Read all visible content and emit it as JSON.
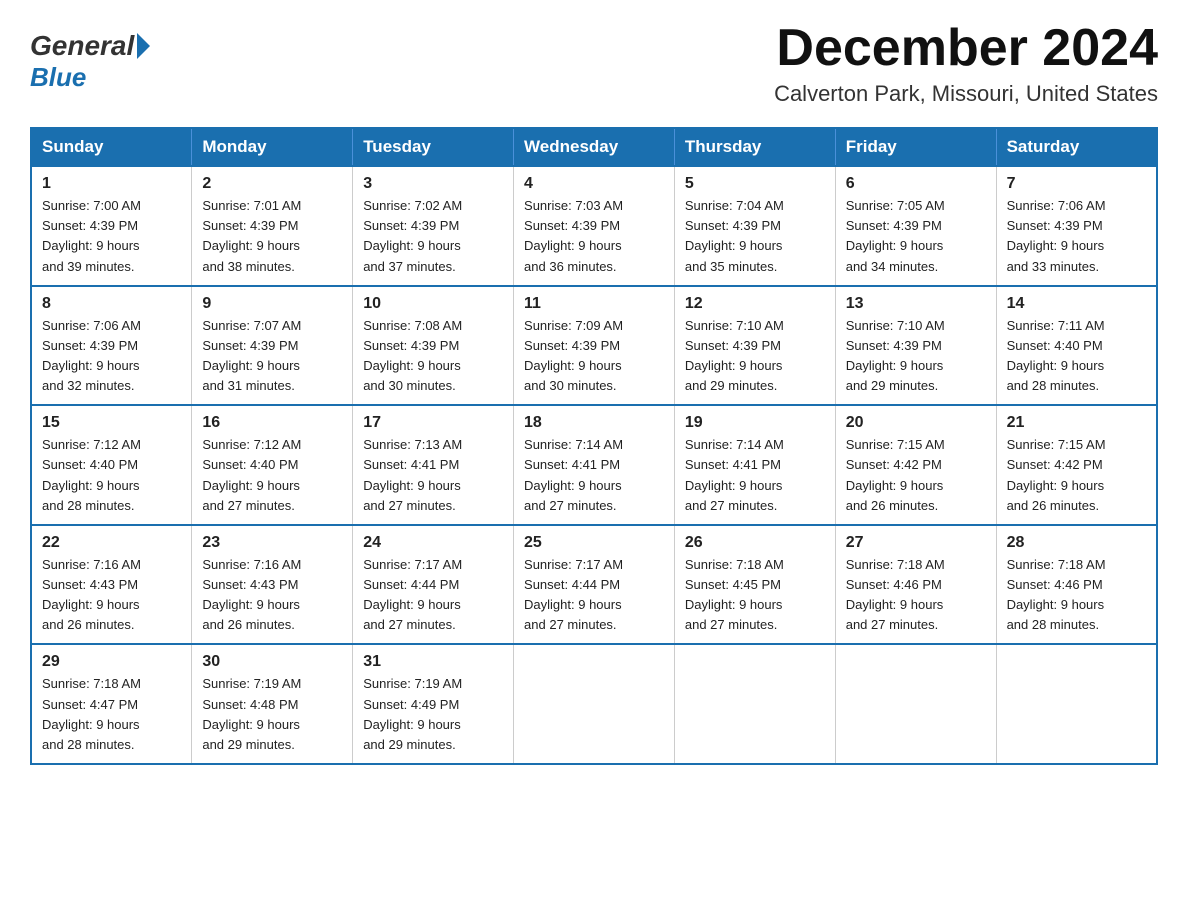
{
  "logo": {
    "general": "General",
    "blue": "Blue"
  },
  "header": {
    "month": "December 2024",
    "location": "Calverton Park, Missouri, United States"
  },
  "days_of_week": [
    "Sunday",
    "Monday",
    "Tuesday",
    "Wednesday",
    "Thursday",
    "Friday",
    "Saturday"
  ],
  "weeks": [
    [
      {
        "day": "1",
        "sunrise": "7:00 AM",
        "sunset": "4:39 PM",
        "daylight": "9 hours and 39 minutes."
      },
      {
        "day": "2",
        "sunrise": "7:01 AM",
        "sunset": "4:39 PM",
        "daylight": "9 hours and 38 minutes."
      },
      {
        "day": "3",
        "sunrise": "7:02 AM",
        "sunset": "4:39 PM",
        "daylight": "9 hours and 37 minutes."
      },
      {
        "day": "4",
        "sunrise": "7:03 AM",
        "sunset": "4:39 PM",
        "daylight": "9 hours and 36 minutes."
      },
      {
        "day": "5",
        "sunrise": "7:04 AM",
        "sunset": "4:39 PM",
        "daylight": "9 hours and 35 minutes."
      },
      {
        "day": "6",
        "sunrise": "7:05 AM",
        "sunset": "4:39 PM",
        "daylight": "9 hours and 34 minutes."
      },
      {
        "day": "7",
        "sunrise": "7:06 AM",
        "sunset": "4:39 PM",
        "daylight": "9 hours and 33 minutes."
      }
    ],
    [
      {
        "day": "8",
        "sunrise": "7:06 AM",
        "sunset": "4:39 PM",
        "daylight": "9 hours and 32 minutes."
      },
      {
        "day": "9",
        "sunrise": "7:07 AM",
        "sunset": "4:39 PM",
        "daylight": "9 hours and 31 minutes."
      },
      {
        "day": "10",
        "sunrise": "7:08 AM",
        "sunset": "4:39 PM",
        "daylight": "9 hours and 30 minutes."
      },
      {
        "day": "11",
        "sunrise": "7:09 AM",
        "sunset": "4:39 PM",
        "daylight": "9 hours and 30 minutes."
      },
      {
        "day": "12",
        "sunrise": "7:10 AM",
        "sunset": "4:39 PM",
        "daylight": "9 hours and 29 minutes."
      },
      {
        "day": "13",
        "sunrise": "7:10 AM",
        "sunset": "4:39 PM",
        "daylight": "9 hours and 29 minutes."
      },
      {
        "day": "14",
        "sunrise": "7:11 AM",
        "sunset": "4:40 PM",
        "daylight": "9 hours and 28 minutes."
      }
    ],
    [
      {
        "day": "15",
        "sunrise": "7:12 AM",
        "sunset": "4:40 PM",
        "daylight": "9 hours and 28 minutes."
      },
      {
        "day": "16",
        "sunrise": "7:12 AM",
        "sunset": "4:40 PM",
        "daylight": "9 hours and 27 minutes."
      },
      {
        "day": "17",
        "sunrise": "7:13 AM",
        "sunset": "4:41 PM",
        "daylight": "9 hours and 27 minutes."
      },
      {
        "day": "18",
        "sunrise": "7:14 AM",
        "sunset": "4:41 PM",
        "daylight": "9 hours and 27 minutes."
      },
      {
        "day": "19",
        "sunrise": "7:14 AM",
        "sunset": "4:41 PM",
        "daylight": "9 hours and 27 minutes."
      },
      {
        "day": "20",
        "sunrise": "7:15 AM",
        "sunset": "4:42 PM",
        "daylight": "9 hours and 26 minutes."
      },
      {
        "day": "21",
        "sunrise": "7:15 AM",
        "sunset": "4:42 PM",
        "daylight": "9 hours and 26 minutes."
      }
    ],
    [
      {
        "day": "22",
        "sunrise": "7:16 AM",
        "sunset": "4:43 PM",
        "daylight": "9 hours and 26 minutes."
      },
      {
        "day": "23",
        "sunrise": "7:16 AM",
        "sunset": "4:43 PM",
        "daylight": "9 hours and 26 minutes."
      },
      {
        "day": "24",
        "sunrise": "7:17 AM",
        "sunset": "4:44 PM",
        "daylight": "9 hours and 27 minutes."
      },
      {
        "day": "25",
        "sunrise": "7:17 AM",
        "sunset": "4:44 PM",
        "daylight": "9 hours and 27 minutes."
      },
      {
        "day": "26",
        "sunrise": "7:18 AM",
        "sunset": "4:45 PM",
        "daylight": "9 hours and 27 minutes."
      },
      {
        "day": "27",
        "sunrise": "7:18 AM",
        "sunset": "4:46 PM",
        "daylight": "9 hours and 27 minutes."
      },
      {
        "day": "28",
        "sunrise": "7:18 AM",
        "sunset": "4:46 PM",
        "daylight": "9 hours and 28 minutes."
      }
    ],
    [
      {
        "day": "29",
        "sunrise": "7:18 AM",
        "sunset": "4:47 PM",
        "daylight": "9 hours and 28 minutes."
      },
      {
        "day": "30",
        "sunrise": "7:19 AM",
        "sunset": "4:48 PM",
        "daylight": "9 hours and 29 minutes."
      },
      {
        "day": "31",
        "sunrise": "7:19 AM",
        "sunset": "4:49 PM",
        "daylight": "9 hours and 29 minutes."
      },
      null,
      null,
      null,
      null
    ]
  ]
}
